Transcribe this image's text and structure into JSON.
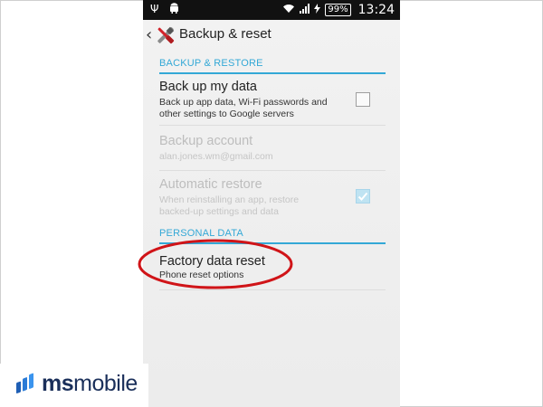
{
  "status_bar": {
    "left_icons": [
      "usb-icon",
      "android-icon"
    ],
    "right_icons": [
      "wifi-icon",
      "signal-icon",
      "charging-icon"
    ],
    "battery": "99%",
    "time": "13:24"
  },
  "action_bar": {
    "back_glyph": "‹",
    "icon": "tools-icon",
    "title": "Backup & reset"
  },
  "sections": {
    "backup_restore": {
      "header": "BACKUP & RESTORE",
      "items": [
        {
          "title": "Back up my data",
          "subtitle": "Back up app data, Wi-Fi passwords and other settings to Google servers",
          "checked": false,
          "enabled": true
        },
        {
          "title": "Backup account",
          "subtitle": "alan.jones.wm@gmail.com",
          "enabled": false
        },
        {
          "title": "Automatic restore",
          "subtitle": "When reinstalling an app, restore backed-up settings and data",
          "checked": true,
          "enabled": false
        }
      ]
    },
    "personal_data": {
      "header": "PERSONAL DATA",
      "items": [
        {
          "title": "Factory data reset",
          "subtitle": "Phone reset options",
          "highlighted": true
        }
      ]
    }
  },
  "colors": {
    "accent": "#33a8d6",
    "highlight_circle": "#d01418",
    "statusbar_bg": "#111111"
  },
  "watermark": {
    "text_bold": "ms",
    "text_regular": "mobile",
    "icon": "msmobile-logo-icon"
  }
}
